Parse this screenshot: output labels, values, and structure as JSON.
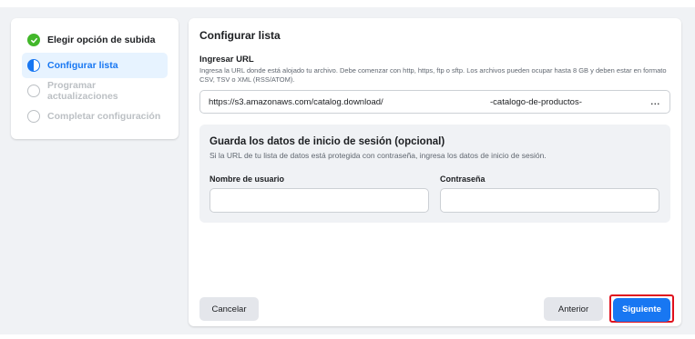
{
  "steps": [
    {
      "label": "Elegir opción de subida",
      "status": "done"
    },
    {
      "label": "Configurar lista",
      "status": "active"
    },
    {
      "label": "Programar actualizaciones",
      "status": "todo"
    },
    {
      "label": "Completar configuración",
      "status": "todo"
    }
  ],
  "main": {
    "title": "Configurar lista",
    "url_label": "Ingresar URL",
    "url_help": "Ingresa la URL donde está alojado tu archivo. Debe comenzar con http, https, ftp o sftp. Los archivos pueden ocupar hasta 8 GB y deben estar en formato CSV, TSV o XML (RSS/ATOM).",
    "url_value_part1": "https://s3.amazonaws.com/catalog.download/",
    "url_value_part2": "-catalogo-de-productos-",
    "url_ellipsis": "...",
    "credentials": {
      "title": "Guarda los datos de inicio de sesión (opcional)",
      "help": "Si la URL de tu lista de datos está protegida con contraseña, ingresa los datos de inicio de sesión.",
      "username_label": "Nombre de usuario",
      "username_value": "",
      "password_label": "Contraseña",
      "password_value": ""
    }
  },
  "buttons": {
    "cancel": "Cancelar",
    "previous": "Anterior",
    "next": "Siguiente"
  },
  "colors": {
    "accent": "#1877f2",
    "done": "#42b72a",
    "highlight_border": "#e0101d"
  }
}
